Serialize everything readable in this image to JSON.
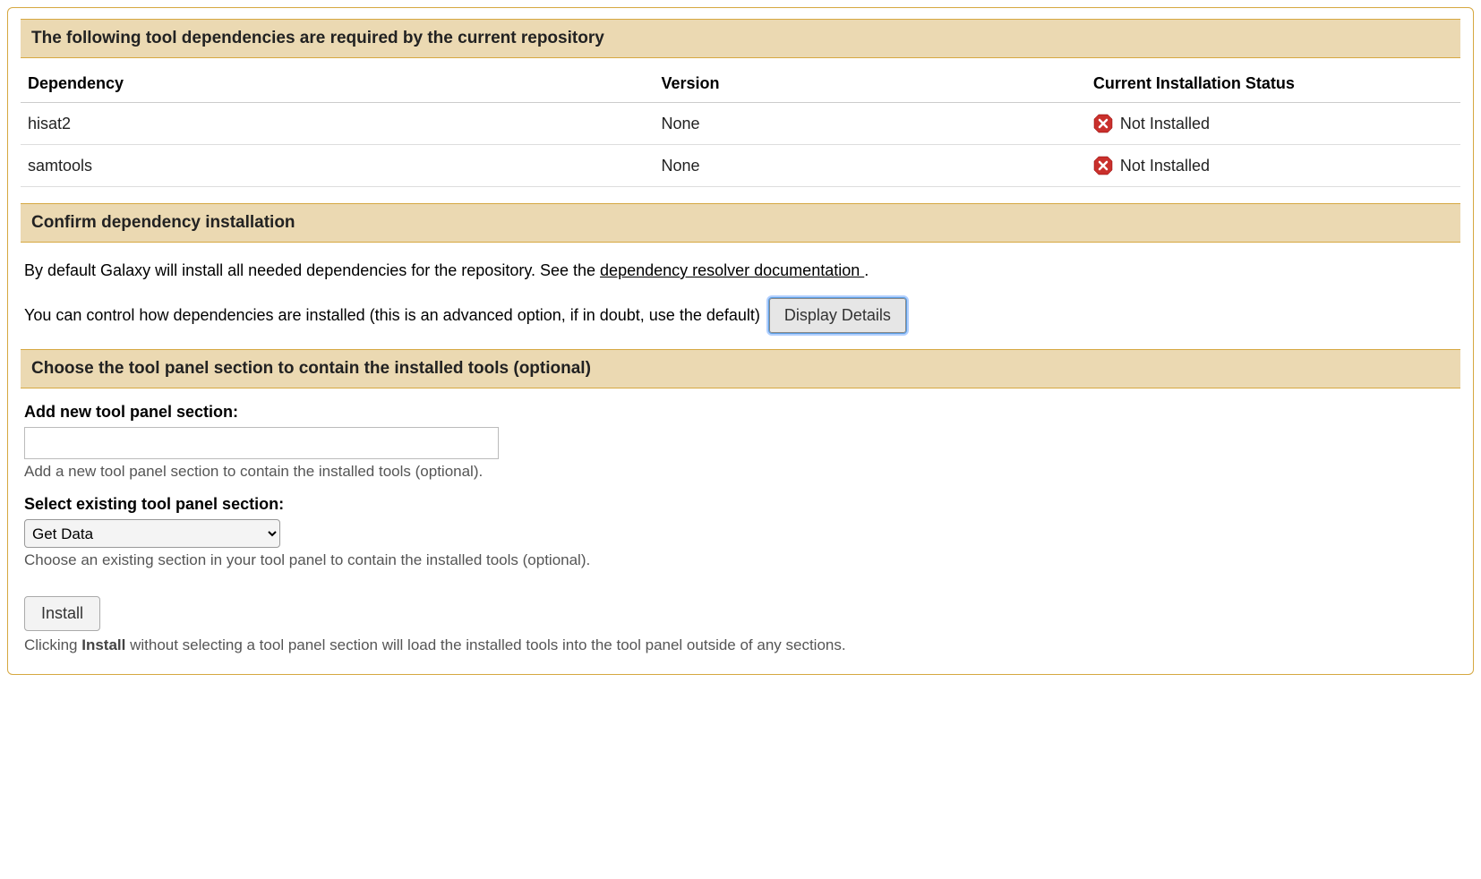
{
  "sections": {
    "dependencies_header": "The following tool dependencies are required by the current repository",
    "confirm_header": "Confirm dependency installation",
    "panel_section_header": "Choose the tool panel section to contain the installed tools (optional)"
  },
  "table": {
    "headers": {
      "dependency": "Dependency",
      "version": "Version",
      "status": "Current Installation Status"
    },
    "rows": [
      {
        "name": "hisat2",
        "version": "None",
        "status": "Not Installed"
      },
      {
        "name": "samtools",
        "version": "None",
        "status": "Not Installed"
      }
    ]
  },
  "confirm": {
    "text_before_link": "By default Galaxy will install all needed dependencies for the repository. See the ",
    "link_text": "dependency resolver documentation ",
    "text_after_link": ".",
    "advanced_text": "You can control how dependencies are installed (this is an advanced option, if in doubt, use the default)",
    "button_label": "Display Details"
  },
  "panel_section": {
    "add_label": "Add new tool panel section:",
    "add_helper": "Add a new tool panel section to contain the installed tools (optional).",
    "select_label": "Select existing tool panel section:",
    "select_value": "Get Data",
    "select_helper": "Choose an existing section in your tool panel to contain the installed tools (optional).",
    "install_button": "Install",
    "install_note_prefix": "Clicking ",
    "install_note_bold": "Install",
    "install_note_suffix": " without selecting a tool panel section will load the installed tools into the tool panel outside of any sections."
  }
}
